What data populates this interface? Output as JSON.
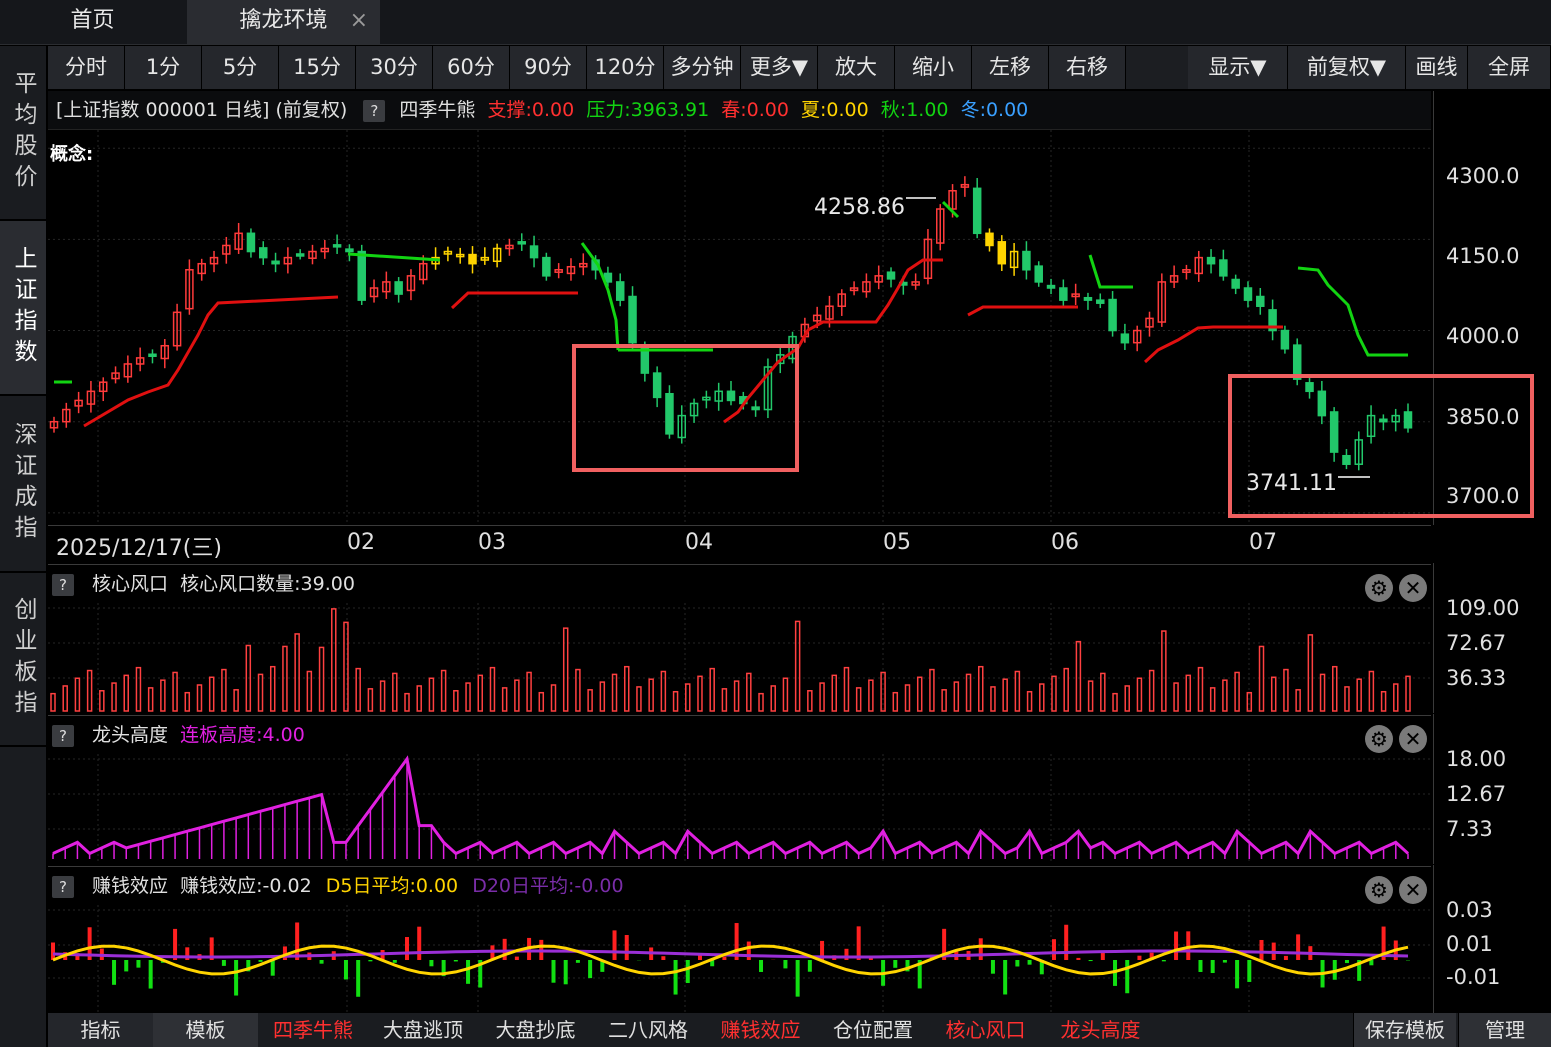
{
  "window_tabs": {
    "home": "首页",
    "active": "擒龙环境",
    "close": "×"
  },
  "toolbar": {
    "left": [
      "分时",
      "1分",
      "5分",
      "15分",
      "30分",
      "60分",
      "90分",
      "120分",
      "多分钟",
      "更多▼",
      "放大",
      "缩小",
      "左移",
      "右移"
    ],
    "right": [
      "显示▼",
      "前复权▼",
      "画线",
      "全屏"
    ]
  },
  "sidebar": [
    "平均股价",
    "上证指数",
    "深证成指",
    "创业板指"
  ],
  "sidebar_active_index": 1,
  "info": {
    "title": "[上证指数 000001 日线] (前复权)",
    "help": "?",
    "indicator": "四季牛熊",
    "support": "支撑:0.00",
    "pressure": "压力:3963.91",
    "spring": "春:0.00",
    "summer": "夏:0.00",
    "autumn": "秋:1.00",
    "winter": "冬:0.00",
    "concept": "概念:"
  },
  "colors": {
    "up": "#ff3b3b",
    "down": "#22c86a",
    "yellow": "#ffd400",
    "green_line": "#12d412",
    "magenta": "#e020e0",
    "purple": "#9a2fd6",
    "box": "#f06060"
  },
  "price_axis": [
    "4300.0",
    "4150.0",
    "4000.0",
    "3850.0",
    "3700.0"
  ],
  "annotations": {
    "high": "4258.86",
    "low": "3741.11"
  },
  "date_axis": [
    "2025/12/17(三)",
    "02",
    "03",
    "04",
    "05",
    "06",
    "07"
  ],
  "panels": {
    "core": {
      "help": "?",
      "name": "核心风口",
      "value": "核心风口数量:39.00",
      "axis": [
        "109.00",
        "72.67",
        "36.33"
      ]
    },
    "dragon": {
      "help": "?",
      "name": "龙头高度",
      "value": "连板高度:4.00",
      "axis": [
        "18.00",
        "12.67",
        "7.33"
      ]
    },
    "money": {
      "help": "?",
      "name": "赚钱效应",
      "value": "赚钱效应:-0.02",
      "d5": "D5日平均:0.00",
      "d20": "D20日平均:-0.00",
      "axis": [
        "0.03",
        "0.01",
        "-0.01"
      ]
    }
  },
  "panel_icons": {
    "gear": "⚙",
    "close": "✕"
  },
  "bottom_tabs": [
    "指标",
    "模板",
    "四季牛熊",
    "大盘逃顶",
    "大盘抄底",
    "二八风格",
    "赚钱效应",
    "仓位配置",
    "核心风口",
    "龙头高度"
  ],
  "bottom_tab_colors": [
    "#e0e0e0",
    "#e0e0e0",
    "#ff3030",
    "#e0e0e0",
    "#e0e0e0",
    "#e0e0e0",
    "#ff3030",
    "#e0e0e0",
    "#ff3030",
    "#ff3030"
  ],
  "bottom_right": [
    "保存模板",
    "管理"
  ],
  "chart_data": {
    "type": "candlestick",
    "y_range": [
      3680,
      4330
    ],
    "candles_approx_close": [
      3850,
      3870,
      3885,
      3900,
      3915,
      3930,
      3945,
      3955,
      3960,
      3975,
      4030,
      4100,
      4110,
      4120,
      4140,
      4160,
      4130,
      4120,
      4110,
      4120,
      4125,
      4130,
      4135,
      4140,
      4130,
      4050,
      4070,
      4080,
      4060,
      4090,
      4110,
      4120,
      4130,
      4125,
      4110,
      4120,
      4135,
      4140,
      4145,
      4120,
      4090,
      4100,
      4105,
      4110,
      4100,
      4080,
      4050,
      3980,
      3930,
      3890,
      3830,
      3860,
      3880,
      3890,
      3900,
      3885,
      3880,
      3870,
      3940,
      3960,
      3990,
      4010,
      4025,
      4040,
      4060,
      4070,
      4080,
      4090,
      4085,
      4075,
      4080,
      4150,
      4200,
      4230,
      4240,
      4160,
      4140,
      4110,
      4130,
      4100,
      4080,
      4070,
      4050,
      4060,
      4050,
      4045,
      4000,
      3980,
      4000,
      4020,
      4080,
      4090,
      4100,
      4120,
      4110,
      4090,
      4070,
      4050,
      4040,
      4000,
      3970,
      3920,
      3900,
      3860,
      3800,
      3780,
      3820,
      3860,
      3850,
      3860,
      3840
    ]
  }
}
